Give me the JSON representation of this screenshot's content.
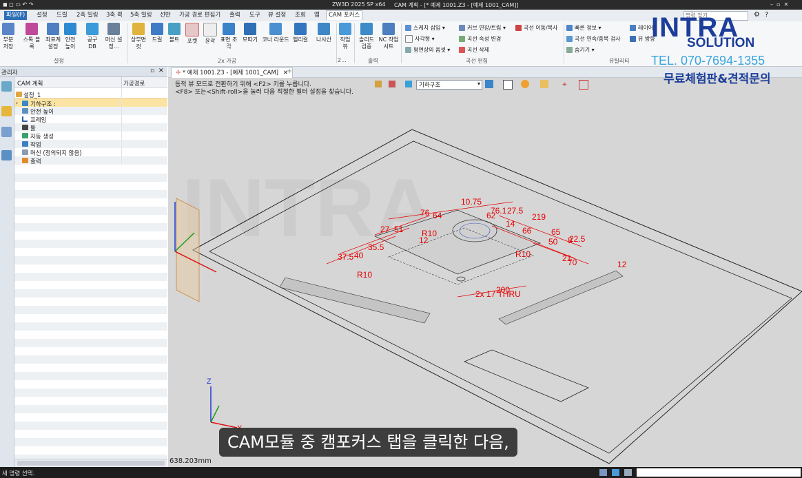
{
  "window": {
    "app_title": "ZW3D 2025 SP x64",
    "doc_title": "CAM 계획 - [* 예제 1001.Z3 - [예제 1001_CAM]]",
    "search_placeholder": "명령 찾기"
  },
  "menu_tabs": [
    "파일(F)",
    "설정",
    "드릴",
    "2축 밀링",
    "3축 퀵",
    "5축 밀링",
    "선반",
    "가공 경로 편집기",
    "출력",
    "도구",
    "뷰 설정",
    "조회",
    "앱",
    "CAM 포커스"
  ],
  "ribbon": {
    "group1": {
      "label": "설정",
      "buttons": [
        "부분 저장",
        "스톡 블록",
        "좌표계 설정",
        "안전 높이",
        "공구 DB",
        "머신 설정..."
      ]
    },
    "group2": {
      "label": "2x 가공",
      "buttons": [
        "상부면 컷",
        "드릴",
        "볼트",
        "포켓",
        "윤곽",
        "표면 조각",
        "모따기",
        "코너 라운드",
        "헬리컬",
        "나사산"
      ]
    },
    "group3": {
      "label": "2...",
      "buttons": [
        "작업 뷰"
      ]
    },
    "group4": {
      "label": "출력",
      "buttons": [
        "솔리드 검증",
        "NC 작업 시트"
      ]
    },
    "group5": {
      "label": "",
      "items": [
        "스케치 삽입",
        "사각형",
        "평면상의 옵셋"
      ]
    },
    "group6": {
      "label": "곡선 편집",
      "items": [
        "커브 연장/트림",
        "곡선 이동/복사",
        "곡선 속성 변경",
        "곡선 삭제"
      ]
    },
    "group7": {
      "label": "유틸리티",
      "items": [
        "빠른 정보",
        "곡선 연속/중복 검사",
        "숨기기",
        "레이어",
        "뷰 방향"
      ]
    }
  },
  "manager": {
    "title": "관리자",
    "col1": "CAM 계획",
    "col2": "가공경로",
    "tree": [
      {
        "label": "설정_1",
        "indent": 0
      },
      {
        "label": "기하구조 :",
        "indent": 1
      },
      {
        "label": "안전 높이",
        "indent": 1
      },
      {
        "label": "프레임",
        "indent": 1
      },
      {
        "label": "툴",
        "indent": 1
      },
      {
        "label": "자동 생성",
        "indent": 1
      },
      {
        "label": "작업",
        "indent": 1
      },
      {
        "label": "머신 (정의되지 않음)",
        "indent": 1
      },
      {
        "label": "출력",
        "indent": 1
      }
    ]
  },
  "viewport": {
    "doc_tab": "* 예제 1001.Z3 - [예제 1001_CAM]",
    "hint_line1": "동적 뷰 모드로 전환하기 위해 <F2> 키를 누릅니다.",
    "hint_line2": "<F8> 또는<Shift-roll>을 눌러 다음 적절한 필터 설정을 찾습니다.",
    "filter_value": "기하구조",
    "scale_readout": "638.203mm",
    "axis_z": "Z",
    "axis_x": "X",
    "dims": [
      "10.75",
      "76.1",
      "27.5",
      "219",
      "76",
      "64",
      "62",
      "14",
      "66",
      "65",
      "27",
      "51",
      "8",
      "50",
      "22.5",
      "R10",
      "12",
      "35.5",
      "37.5",
      "40",
      "R10",
      "21",
      "70",
      "200",
      "2x 17 THRU",
      "R10",
      "12"
    ]
  },
  "subtitle": "CAM모듈 중 캠포커스 탭을 클릭한 다음,",
  "status": {
    "message": "새 명령 선택."
  },
  "brand": {
    "name": "INTRA",
    "sub": "SOLUTION",
    "phone": "TEL. 070-7694-1355",
    "promo": "무료체험판&견적문의"
  },
  "colors": {
    "accent": "#2f6fb6",
    "dimension": "#e60000",
    "brand_blue": "#1c3e9a",
    "brand_cyan": "#3aa5e0"
  }
}
